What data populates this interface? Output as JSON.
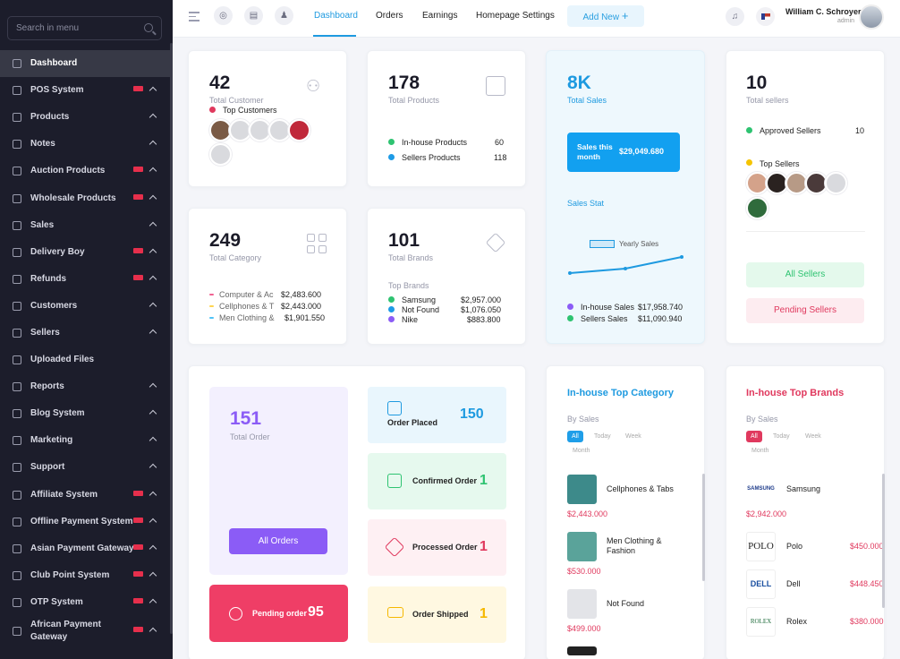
{
  "sidebar": {
    "search_placeholder": "Search in menu",
    "items": [
      {
        "label": "Dashboard",
        "icon": "dashboard-icon"
      },
      {
        "label": "POS System",
        "icon": "pos-icon",
        "badge": true,
        "chevron": true
      },
      {
        "label": "Products",
        "icon": "products-icon",
        "chevron": true
      },
      {
        "label": "Notes",
        "icon": "notes-icon",
        "chevron": true
      },
      {
        "label": "Auction Products",
        "icon": "auction-icon",
        "badge": true,
        "chevron": true
      },
      {
        "label": "Wholesale Products",
        "icon": "wholesale-icon",
        "badge": true,
        "chevron": true
      },
      {
        "label": "Sales",
        "icon": "sales-icon",
        "chevron": true
      },
      {
        "label": "Delivery Boy",
        "icon": "delivery-icon",
        "badge": true,
        "chevron": true
      },
      {
        "label": "Refunds",
        "icon": "refunds-icon",
        "badge": true,
        "chevron": true
      },
      {
        "label": "Customers",
        "icon": "customers-icon",
        "chevron": true
      },
      {
        "label": "Sellers",
        "icon": "sellers-icon",
        "chevron": true
      },
      {
        "label": "Uploaded Files",
        "icon": "upload-icon"
      },
      {
        "label": "Reports",
        "icon": "reports-icon",
        "chevron": true
      },
      {
        "label": "Blog System",
        "icon": "blog-icon",
        "chevron": true
      },
      {
        "label": "Marketing",
        "icon": "marketing-icon",
        "chevron": true
      },
      {
        "label": "Support",
        "icon": "support-icon",
        "chevron": true
      },
      {
        "label": "Affiliate System",
        "icon": "affiliate-icon",
        "badge": true,
        "chevron": true
      },
      {
        "label": "Offline Payment System",
        "icon": "offline-payment-icon",
        "badge": true,
        "chevron": true
      },
      {
        "label": "Asian Payment Gateway",
        "icon": "asian-payment-icon",
        "badge": true,
        "chevron": true
      },
      {
        "label": "Club Point System",
        "icon": "club-point-icon",
        "badge": true,
        "chevron": true
      },
      {
        "label": "OTP System",
        "icon": "otp-icon",
        "badge": true,
        "chevron": true
      },
      {
        "label": "African Payment Gateway",
        "icon": "african-payment-icon",
        "badge": true,
        "chevron": true
      }
    ]
  },
  "topbar": {
    "tabs": [
      "Dashboard",
      "Orders",
      "Earnings",
      "Homepage Settings"
    ],
    "add_new": "Add New",
    "user_name": "William C. Schroyer",
    "user_role": "admin"
  },
  "customers": {
    "value": "42",
    "label": "Total Customer",
    "top": "Top Customers"
  },
  "products": {
    "value": "178",
    "label": "Total Products",
    "inhouse_label": "In-house Products",
    "inhouse_value": "60",
    "seller_label": "Sellers Products",
    "seller_value": "118"
  },
  "sales": {
    "value": "8K",
    "label": "Total Sales",
    "month_label": "Sales this month",
    "month_value": "$29,049.680",
    "stat_title": "Sales Stat",
    "legend": "Yearly Sales",
    "inhouse_label": "In-house Sales",
    "inhouse_value": "$17,958.740",
    "sellers_label": "Sellers Sales",
    "sellers_value": "$11,090.940"
  },
  "sellers": {
    "value": "10",
    "label": "Total sellers",
    "approved_label": "Approved Sellers",
    "approved_value": "10",
    "top": "Top Sellers",
    "all_btn": "All Sellers",
    "pending_btn": "Pending Sellers"
  },
  "category": {
    "value": "249",
    "label": "Total Category",
    "rows": [
      {
        "name": "Computer & Ac",
        "amount": "$2,483.600",
        "color": "#f06292"
      },
      {
        "name": "Cellphones & T",
        "amount": "$2,443.000",
        "color": "#ffd54f"
      },
      {
        "name": "Men Clothing &",
        "amount": "$1,901.550",
        "color": "#4fc3f7"
      }
    ]
  },
  "brands": {
    "value": "101",
    "label": "Total Brands",
    "top": "Top Brands",
    "rows": [
      {
        "name": "Samsung",
        "amount": "$2,957.000",
        "color": "#2ec371"
      },
      {
        "name": "Not Found",
        "amount": "$1,076.050",
        "color": "#1e9be6"
      },
      {
        "name": "Nike",
        "amount": "$883.800",
        "color": "#8b5cf6"
      }
    ]
  },
  "orders": {
    "total_value": "151",
    "total_label": "Total Order",
    "all_btn": "All Orders",
    "pending_label": "Pending order",
    "pending_value": "95",
    "placed_label": "Order Placed",
    "placed_value": "150",
    "confirmed_label": "Confirmed Order",
    "confirmed_value": "1",
    "processed_label": "Processed Order",
    "processed_value": "1",
    "shipped_label": "Order Shipped",
    "shipped_value": "1"
  },
  "top_category": {
    "title": "In-house Top Category",
    "by": "By Sales",
    "filters": [
      "All",
      "Today",
      "Week",
      "Month"
    ],
    "items": [
      {
        "name": "Cellphones & Tabs",
        "price": "$2,443.000"
      },
      {
        "name": "Men Clothing & Fashion",
        "price": "$530.000"
      },
      {
        "name": "Not Found",
        "price": "$499.000"
      }
    ]
  },
  "top_brands": {
    "title": "In-house Top Brands",
    "by": "By Sales",
    "filters": [
      "All",
      "Today",
      "Week",
      "Month"
    ],
    "items": [
      {
        "name": "Samsung",
        "price": "$2,942.000",
        "logo": "SAMSUNG"
      },
      {
        "name": "Polo",
        "price": "$450.000",
        "logo": "POLO"
      },
      {
        "name": "Dell",
        "price": "$448.450",
        "logo": "DELL"
      },
      {
        "name": "Rolex",
        "price": "$380.000",
        "logo": "ROLEX"
      }
    ]
  },
  "colors": {
    "accent": "#1e9ae0",
    "purple": "#8b5cf6",
    "pink": "#e0395e",
    "sidebar": "#1c1d2b"
  }
}
